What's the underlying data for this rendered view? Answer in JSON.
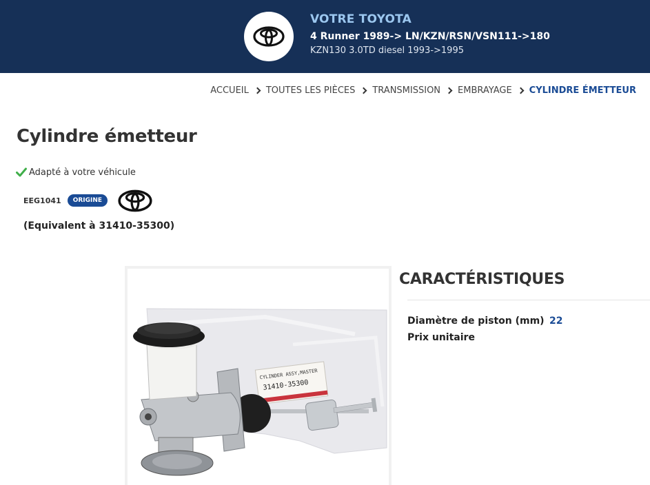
{
  "header": {
    "brand_line": "VOTRE TOYOTA",
    "model_line": "4 Runner 1989-> LN/KZN/RSN/VSN111->180",
    "engine_line": "KZN130 3.0TD diesel 1993->1995",
    "logo_icon": "toyota-logo-icon",
    "background_color": "#163057"
  },
  "breadcrumb": {
    "items": [
      "ACCUEIL",
      "TOUTES LES PIÈCES",
      "TRANSMISSION",
      "EMBRAYAGE"
    ],
    "current": "CYLINDRE ÉMETTEUR",
    "separator_icon": "chevron-right-icon",
    "current_color": "#1a4b95"
  },
  "product": {
    "title": "Cylindre émetteur",
    "fit_text": "Adapté à votre véhicule",
    "fit_icon": "check-icon",
    "ref_code": "EEG1041",
    "badge": "ORIGINE",
    "brand_icon": "toyota-logo-icon",
    "equivalent": "(Equivalent à 31410-35300)",
    "image_label_line1": "CYLINDER ASSY,MASTER",
    "image_label_line2": "31410-35300"
  },
  "characteristics": {
    "title": "CARACTÉRISTIQUES",
    "rows": [
      {
        "label": "Diamètre de piston (mm)",
        "value": "22"
      },
      {
        "label": "Prix unitaire",
        "value": ""
      }
    ]
  }
}
